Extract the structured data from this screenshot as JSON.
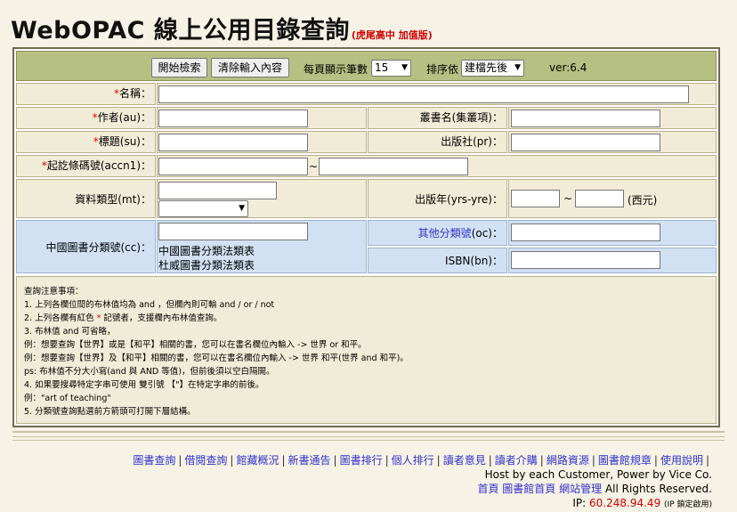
{
  "header": {
    "title": "WebOPAC 線上公用目錄查詢",
    "subtitle": "(虎尾高中 加值版)"
  },
  "toolbar": {
    "search_label": "開始檢索",
    "clear_label": "清除輸入內容",
    "per_page_label": "每頁顯示筆數",
    "per_page_value": "15",
    "sort_label": "排序依",
    "sort_value": "建檔先後",
    "version": "ver:6.4"
  },
  "fields": {
    "title_label": "名稱：",
    "author_label": "作者(au)：",
    "series_label": "叢書名(集叢項)：",
    "subject_label": "標題(su)：",
    "publisher_label": "出版社(pr)：",
    "accn_label": "起訖條碼號(accn1)：",
    "accn_sep": "~",
    "type_label": "資料類型(mt)：",
    "year_label": "出版年(yrs-yre)：",
    "year_sep": "~",
    "year_unit": "(西元)",
    "cc_label": "中國圖書分類號(cc)：",
    "cc_link1": "中國圖書分類法類表",
    "cc_link2": "杜威圖書分類法類表",
    "oc_label": "其他分類號",
    "oc_suffix": "(oc)：",
    "isbn_label": "ISBN(bn)：",
    "required_mark": "*"
  },
  "notes": [
    "查詢注意事項：",
    "1. 上列各欄位間的布林值均為 and ，但欄內則可輸 and / or / not",
    "2. 上列各欄有紅色 * 記號者，支援欄內布林值查詢。",
    "3. 布林值 and 可省略，",
    "例：想要查詢【世界】或是【和平】相關的書，您可以在書名欄位內輸入 -> 世界 or 和平。",
    "例：想要查詢【世界】及【和平】相關的書，您可以在書名欄位內輸入 -> 世界 和平(世界 and 和平)。",
    "ps: 布林值不分大小寫(and 與 AND 等值)，但前後須以空白隔開。",
    "4. 如果要搜尋特定字串可使用 雙引號 【\"】在特定字串的前後。",
    "例：\"art of teaching\"",
    "5. 分類號查詢點選前方箭頭可打開下層結構。"
  ],
  "footer": {
    "links": [
      "圖書查詢",
      "借閱查詢",
      "館藏概況",
      "新書通告",
      "圖書排行",
      "個人排行",
      "讀者意見",
      "讀者介購",
      "網路資源",
      "圖書館規章",
      "使用說明"
    ],
    "host_line": "Host by each Customer, Power by Vice Co.",
    "bottom_links": [
      "首頁",
      "圖書館首頁",
      "網站管理"
    ],
    "rights": "All Rights Reserved.",
    "ip_label": "IP:",
    "ip_value": "60.248.94.49",
    "ip_note": "(IP 鎖定啟用)"
  }
}
